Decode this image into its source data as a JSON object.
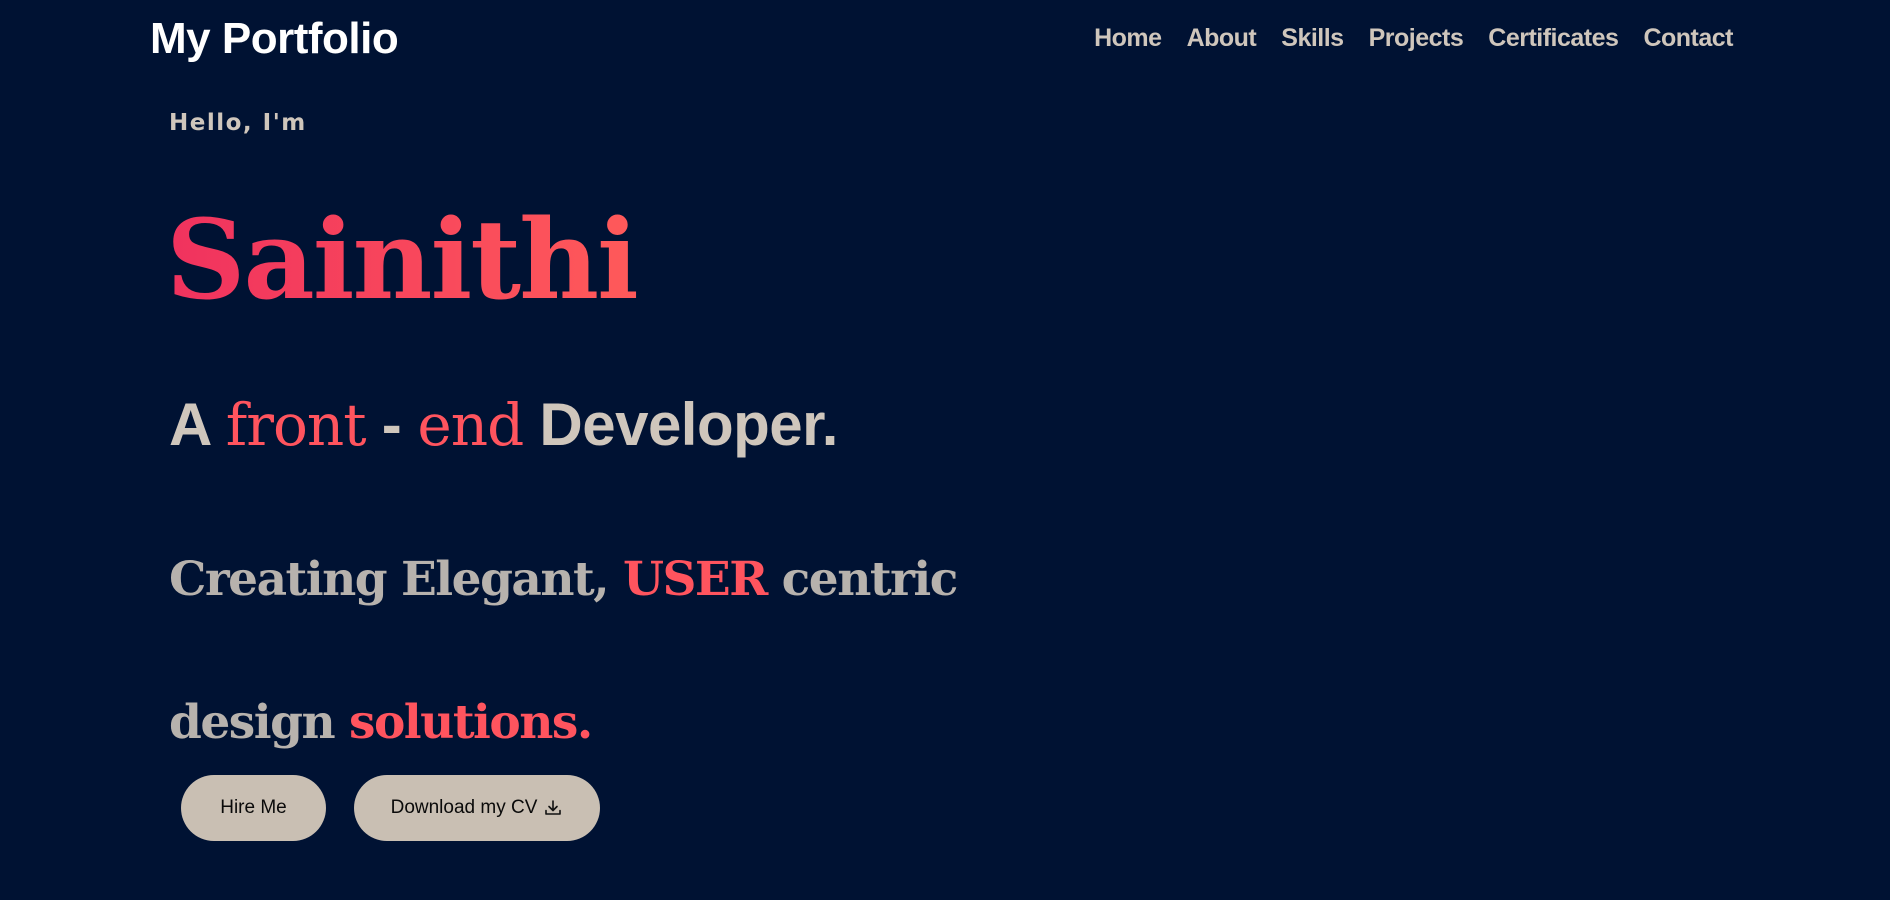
{
  "header": {
    "brand": "My Portfolio",
    "nav": [
      "Home",
      "About",
      "Skills",
      "Projects",
      "Certificates",
      "Contact"
    ]
  },
  "hero": {
    "greeting": "Hello, I'm",
    "name": "Sainithi",
    "role": {
      "prefix": "A ",
      "accent1": "front",
      "dash": " - ",
      "accent2": "end",
      "suffix": " Developer."
    },
    "tagline_line1": {
      "before": "Creating Elegant, ",
      "accent": "USER",
      "after": " centric"
    },
    "tagline_line2": {
      "before": "design ",
      "accent": "solutions."
    }
  },
  "buttons": {
    "hire": "Hire Me",
    "cv": "Download my CV",
    "cv_icon": "download-icon"
  },
  "colors": {
    "background": "#001233",
    "accent": "#ff545e",
    "text": "#cfc6bc",
    "button_bg": "#c9bfb3"
  }
}
